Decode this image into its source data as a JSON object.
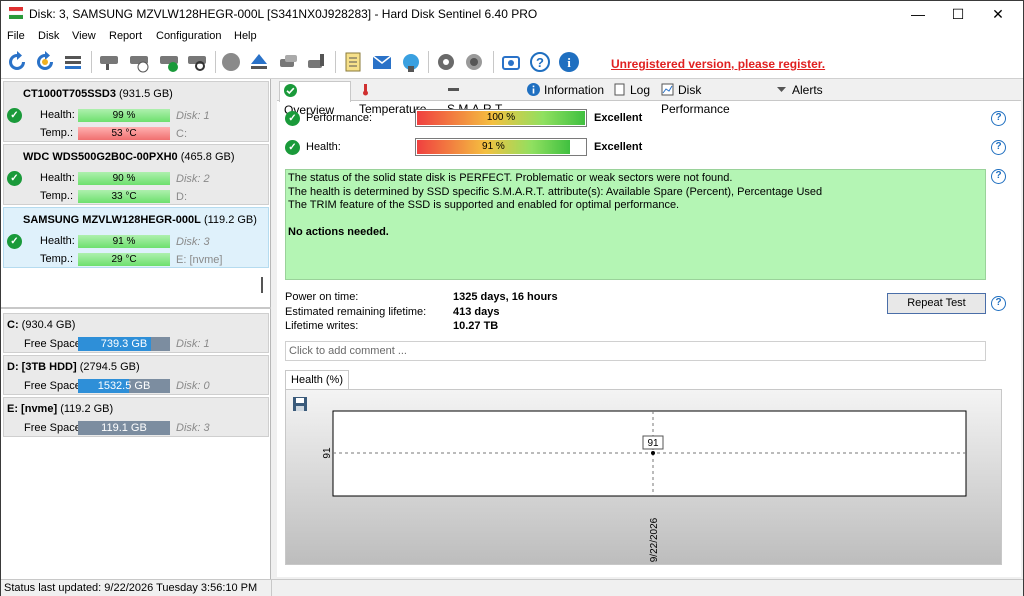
{
  "window": {
    "title": "Disk: 3, SAMSUNG MZVLW128HEGR-000L [S341NX0J928283]  -  Hard Disk Sentinel 6.40 PRO",
    "minimize": "—",
    "maximize": "☐",
    "close": "✕"
  },
  "menu": [
    "File",
    "Disk",
    "View",
    "Report",
    "Configuration",
    "Help"
  ],
  "toolbar": {
    "icons": [
      "refresh-icon",
      "refresh-all-icon",
      "disk-list-icon",
      "disk-test-icon",
      "disk-schedule-icon",
      "disk-ok-icon",
      "disk-search-icon",
      "disk-erase-icon",
      "eject-icon",
      "disk-copy-icon",
      "disk-tool-icon",
      "report-icon",
      "email-icon",
      "network-icon",
      "settings-icon",
      "sound-icon",
      "screenshot-icon",
      "help-icon",
      "info-icon"
    ],
    "unregistered": "Unregistered version, please register."
  },
  "disks": [
    {
      "name": "CT1000T705SSD3",
      "size": "(931.5 GB)",
      "health_label": "Health:",
      "health": "99 %",
      "health_pct": 99,
      "temp_label": "Temp.:",
      "temp": "53 °C",
      "temp_hot": true,
      "disk": "Disk: 1",
      "drive": "C:"
    },
    {
      "name": "WDC WDS500G2B0C-00PXH0",
      "size": "(465.8 GB)",
      "health_label": "Health:",
      "health": "90 %",
      "health_pct": 90,
      "temp_label": "Temp.:",
      "temp": "33 °C",
      "temp_hot": false,
      "disk": "Disk: 2",
      "drive": "D:"
    },
    {
      "name": "SAMSUNG MZVLW128HEGR-000L",
      "size": "(119.2 GB)",
      "health_label": "Health:",
      "health": "91 %",
      "health_pct": 91,
      "temp_label": "Temp.:",
      "temp": "29 °C",
      "temp_hot": false,
      "disk": "Disk: 3",
      "drive": "E: [nvme]",
      "selected": true
    }
  ],
  "volumes": [
    {
      "name": "C:",
      "size": "(930.4 GB)",
      "free_label": "Free Space",
      "free": "739.3 GB",
      "free_fraction": 0.79,
      "disk": "Disk: 1"
    },
    {
      "name": "D: [3TB HDD]",
      "size": "(2794.5 GB)",
      "free_label": "Free Space",
      "free": "1532.5 GB",
      "free_fraction": 0.55,
      "disk": "Disk: 0"
    },
    {
      "name": "E: [nvme]",
      "size": "(119.2 GB)",
      "free_label": "Free Space",
      "free": "119.1 GB",
      "free_fraction": 0.0,
      "disk": "Disk: 3"
    }
  ],
  "tabs": [
    {
      "label": "Overview",
      "icon": "check-icon",
      "active": true
    },
    {
      "label": "Temperature",
      "icon": "thermometer-icon"
    },
    {
      "label": "S.M.A.R.T.",
      "icon": "smart-icon"
    },
    {
      "label": "Information",
      "icon": "info-icon"
    },
    {
      "label": "Log",
      "icon": "log-icon"
    },
    {
      "label": "Disk Performance",
      "icon": "performance-icon"
    },
    {
      "label": "Alerts",
      "icon": "alerts-icon"
    }
  ],
  "overview": {
    "performance_label": "Performance:",
    "performance_value": "100 %",
    "performance_pct": 100,
    "performance_grade": "Excellent",
    "health_label": "Health:",
    "health_value": "91 %",
    "health_pct": 91,
    "health_grade": "Excellent",
    "messages": [
      "The status of the solid state disk is PERFECT. Problematic or weak sectors were not found.",
      "The health is determined by SSD specific S.M.A.R.T. attribute(s):  Available Spare (Percent), Percentage Used",
      "The TRIM feature of the SSD is supported and enabled for optimal performance."
    ],
    "action": "No actions needed.",
    "power_on_label": "Power on time:",
    "power_on_value": "1325 days, 16 hours",
    "lifetime_label": "Estimated remaining lifetime:",
    "lifetime_value": "413 days",
    "writes_label": "Lifetime writes:",
    "writes_value": "10.27 TB",
    "repeat_button": "Repeat Test",
    "comment_placeholder": "Click to add comment ...",
    "health_tab": "Health (%)",
    "help": "?"
  },
  "chart_data": {
    "type": "line",
    "x": [
      "9/22/2026"
    ],
    "series": [
      {
        "values": [
          91
        ]
      }
    ],
    "y_tick": "91",
    "point_label": "91",
    "grid": true
  },
  "status": "Status last updated: 9/22/2026 Tuesday 3:56:10 PM"
}
